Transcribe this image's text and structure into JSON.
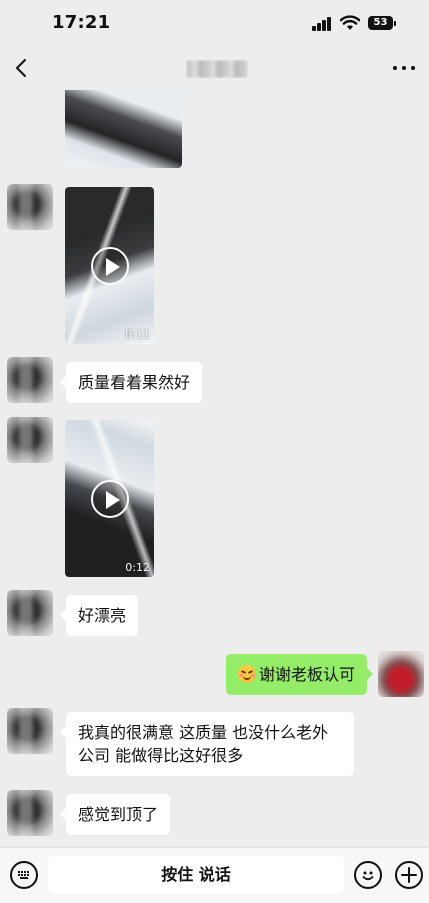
{
  "status_bar": {
    "time": "17:21",
    "battery": "53",
    "icons": [
      "signal-icon",
      "wifi-icon",
      "battery-icon"
    ]
  },
  "nav_bar": {
    "title": "",
    "icons": [
      "back-icon",
      "more-icon"
    ]
  },
  "messages": [
    {
      "side": "left",
      "kind": "image"
    },
    {
      "side": "left",
      "kind": "video",
      "duration": "0:11"
    },
    {
      "side": "left",
      "kind": "text",
      "text": "质量看着果然好"
    },
    {
      "side": "left",
      "kind": "video",
      "duration": "0:12"
    },
    {
      "side": "left",
      "kind": "text",
      "text": "好漂亮"
    },
    {
      "side": "right",
      "kind": "text",
      "emoji": "smile-blush-emoji",
      "text": "谢谢老板认可"
    },
    {
      "side": "left",
      "kind": "text",
      "text": "我真的很满意 这质量 也没什么老外公司 能做得比这好很多"
    },
    {
      "side": "left",
      "kind": "text",
      "text": "感觉到顶了"
    }
  ],
  "input_bar": {
    "hold_to_talk_label": "按住 说话",
    "icons": [
      "voice-keyboard-icon",
      "emoji-icon",
      "plus-icon"
    ]
  },
  "colors": {
    "background": "#ededed",
    "incoming_bubble": "#ffffff",
    "outgoing_bubble": "#95ec69"
  }
}
